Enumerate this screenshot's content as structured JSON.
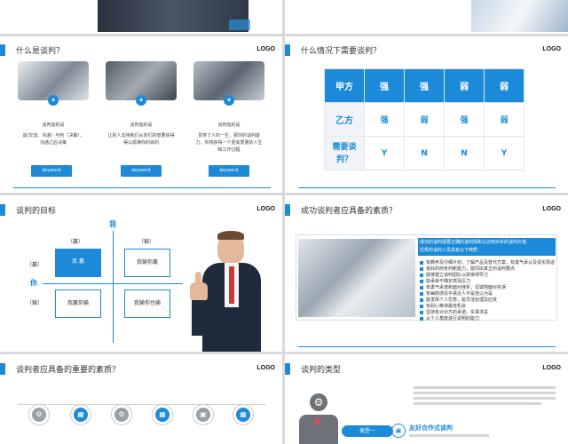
{
  "s2": {
    "title": "什么是谈判？",
    "logo": "LOGO",
    "cols": [
      {
        "heading": "谈判指的是",
        "text": "谈(交流、沟通）与判（决策），沟通之后决策",
        "btn": "keyword"
      },
      {
        "heading": "谈判指的是",
        "text": "让别人支持我们从你们的想要获得得以顺满你的目的",
        "btn": "keyword"
      },
      {
        "heading": "谈判指的是",
        "text": "贯穿了人的一生，那你的谈判能力，你将获得一个更高质量的人生和工作过程",
        "btn": "keyword"
      }
    ]
  },
  "s3": {
    "title": "什么情况下需要谈判？",
    "logo": "LOGO",
    "header": [
      "甲方",
      "强",
      "强",
      "弱",
      "弱"
    ],
    "row2": [
      "乙方",
      "强",
      "弱",
      "强",
      "弱"
    ],
    "row3_label": "需要谈判？",
    "row3": [
      "Y",
      "N",
      "N",
      "Y"
    ]
  },
  "s4": {
    "title": "谈判的目标",
    "logo": "LOGO",
    "y_axis": "我",
    "x_axis": "你",
    "win": "（赢）",
    "lose": "（输）",
    "win2": "（赢）",
    "lose2": "（输）",
    "q1": "双 赢",
    "q2": "我输你赢",
    "q3": "我赢你输",
    "q4": "我输你也输"
  },
  "s5": {
    "title": "成功谈判者应具备的素质？",
    "logo": "LOGO",
    "lead": "成功的谈判需要正确的谈判观和认识到对手的谈判价值",
    "lead2": "优秀的谈判人员具有以下特质：",
    "items": [
      "有教养及仔细计划，了解产品及替代方案，有勇气承认及说实情话",
      "良好的商务判断能力，能同出真正的谈判要点",
      "能够建立谈判团队以获得领导力",
      "能承受不确定感及压力",
      "有勇气承诺和面对挫折，坦诚地面对失误",
      "有幽默感及平易近人不是自以为是",
      "能发挥个人优势，能灵活处理及应变",
      "有耐心等待最佳机会",
      "坚持有对对方的承诺，实事求是",
      "从个人角度进行说明的能力"
    ]
  },
  "s6": {
    "title": "谈判者应具备的重要的素质？",
    "logo": "LOGO"
  },
  "s7": {
    "title": "谈判的类型",
    "logo": "LOGO",
    "type_btn": "类型一",
    "type_label": "友好合作式谈判"
  },
  "colors": {
    "accent": "#1c8ad8"
  }
}
